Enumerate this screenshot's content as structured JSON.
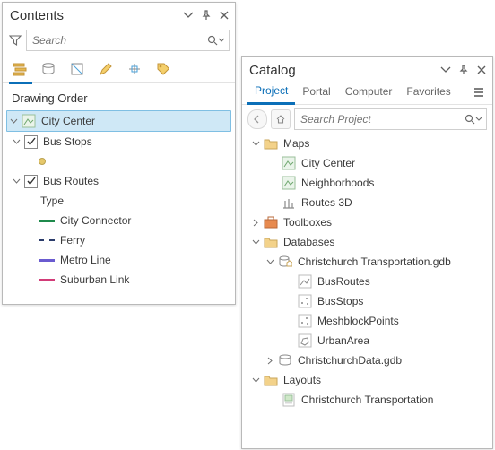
{
  "contents": {
    "title": "Contents",
    "search_placeholder": "Search",
    "section": "Drawing Order",
    "tree": {
      "map": "City Center",
      "layers": [
        {
          "name": "Bus Stops"
        },
        {
          "name": "Bus Routes",
          "field": "Type",
          "classes": [
            "City Connector",
            "Ferry",
            "Metro Line",
            "Suburban Link"
          ],
          "colors": [
            "#1f8a4c",
            "#2b3b6b",
            "#6a5bd0",
            "#d23b78"
          ]
        }
      ]
    }
  },
  "catalog": {
    "title": "Catalog",
    "tabs": [
      "Project",
      "Portal",
      "Computer",
      "Favorites"
    ],
    "active_tab": "Project",
    "search_placeholder": "Search Project",
    "tree": [
      {
        "name": "Maps",
        "expanded": true,
        "children": [
          "City Center",
          "Neighborhoods",
          "Routes 3D"
        ]
      },
      {
        "name": "Toolboxes",
        "expanded": false
      },
      {
        "name": "Databases",
        "expanded": true,
        "children": [
          {
            "name": "Christchurch Transportation.gdb",
            "expanded": true,
            "children": [
              "BusRoutes",
              "BusStops",
              "MeshblockPoints",
              "UrbanArea"
            ]
          },
          {
            "name": "ChristchurchData.gdb",
            "expanded": false
          }
        ]
      },
      {
        "name": "Layouts",
        "expanded": true,
        "children": [
          "Christchurch Transportation"
        ]
      }
    ]
  }
}
